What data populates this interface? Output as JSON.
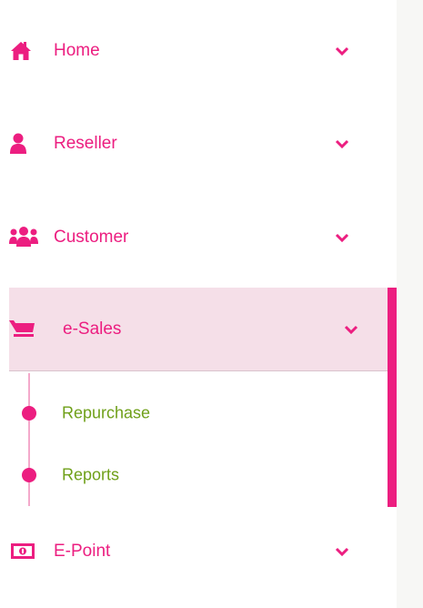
{
  "sidebar": {
    "accent_color": "#ec1e80",
    "submenu_color": "#6fa019",
    "active_bg": "#f5dfe8",
    "items": [
      {
        "label": "Home",
        "icon": "home-icon"
      },
      {
        "label": "Reseller",
        "icon": "user-icon"
      },
      {
        "label": "Customer",
        "icon": "users-icon"
      },
      {
        "label": "e-Sales",
        "icon": "cart-icon",
        "active": true,
        "children": [
          {
            "label": "Repurchase"
          },
          {
            "label": "Reports"
          }
        ]
      },
      {
        "label": "E-Point",
        "icon": "money-icon"
      }
    ]
  }
}
